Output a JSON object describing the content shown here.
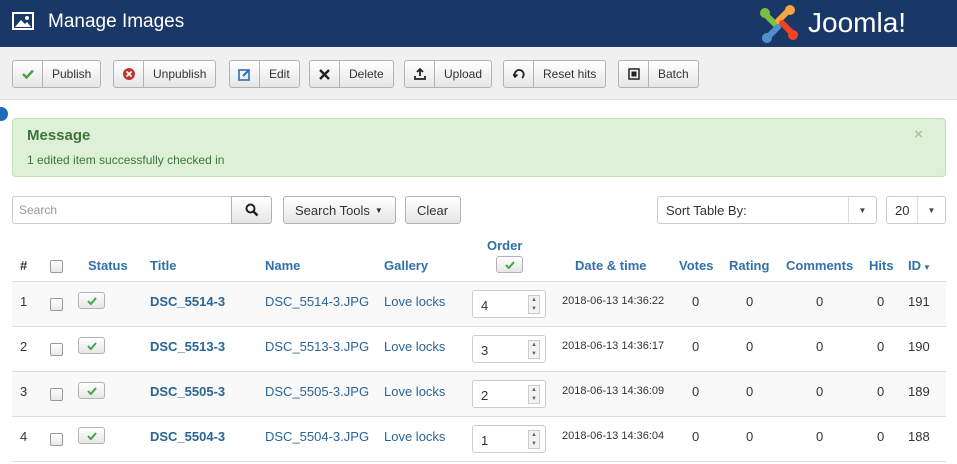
{
  "header": {
    "title": "Manage Images",
    "logo_text": "Joomla!"
  },
  "toolbar": [
    {
      "label": "Publish",
      "icon": "check-icon",
      "color": "#46a546"
    },
    {
      "label": "Unpublish",
      "icon": "circle-x-icon",
      "color": "#bd362f"
    },
    {
      "label": "Edit",
      "icon": "edit-icon",
      "color": "#2f6fb3"
    },
    {
      "label": "Delete",
      "icon": "x-icon",
      "color": "#333333"
    },
    {
      "label": "Upload",
      "icon": "upload-icon",
      "color": "#333333"
    },
    {
      "label": "Reset hits",
      "icon": "refresh-icon",
      "color": "#333333"
    },
    {
      "label": "Batch",
      "icon": "batch-icon",
      "color": "#333333"
    }
  ],
  "message": {
    "heading": "Message",
    "text": "1 edited item successfully checked in",
    "close": "×"
  },
  "filters": {
    "search_placeholder": "Search",
    "search_tools": "Search Tools",
    "clear": "Clear",
    "sort_label": "Sort Table By:",
    "limit": "20"
  },
  "table": {
    "headers": {
      "num": "#",
      "status": "Status",
      "title": "Title",
      "name": "Name",
      "gallery": "Gallery",
      "order": "Order",
      "date": "Date & time",
      "votes": "Votes",
      "rating": "Rating",
      "comments": "Comments",
      "hits": "Hits",
      "id": "ID"
    },
    "rows": [
      {
        "num": "1",
        "title": "DSC_5514-3",
        "name": "DSC_5514-3.JPG",
        "gallery": "Love locks",
        "order": "4",
        "date": "2018-06-13 14:36:22",
        "votes": "0",
        "rating": "0",
        "comments": "0",
        "hits": "0",
        "id": "191"
      },
      {
        "num": "2",
        "title": "DSC_5513-3",
        "name": "DSC_5513-3.JPG",
        "gallery": "Love locks",
        "order": "3",
        "date": "2018-06-13 14:36:17",
        "votes": "0",
        "rating": "0",
        "comments": "0",
        "hits": "0",
        "id": "190"
      },
      {
        "num": "3",
        "title": "DSC_5505-3",
        "name": "DSC_5505-3.JPG",
        "gallery": "Love locks",
        "order": "2",
        "date": "2018-06-13 14:36:09",
        "votes": "0",
        "rating": "0",
        "comments": "0",
        "hits": "0",
        "id": "189"
      },
      {
        "num": "4",
        "title": "DSC_5504-3",
        "name": "DSC_5504-3.JPG",
        "gallery": "Love locks",
        "order": "1",
        "date": "2018-06-13 14:36:04",
        "votes": "0",
        "rating": "0",
        "comments": "0",
        "hits": "0",
        "id": "188"
      }
    ]
  },
  "colors": {
    "header_bg": "#1a3867",
    "link": "#2a6496",
    "success_bg": "#dff0d8",
    "success_text": "#3c763d"
  }
}
